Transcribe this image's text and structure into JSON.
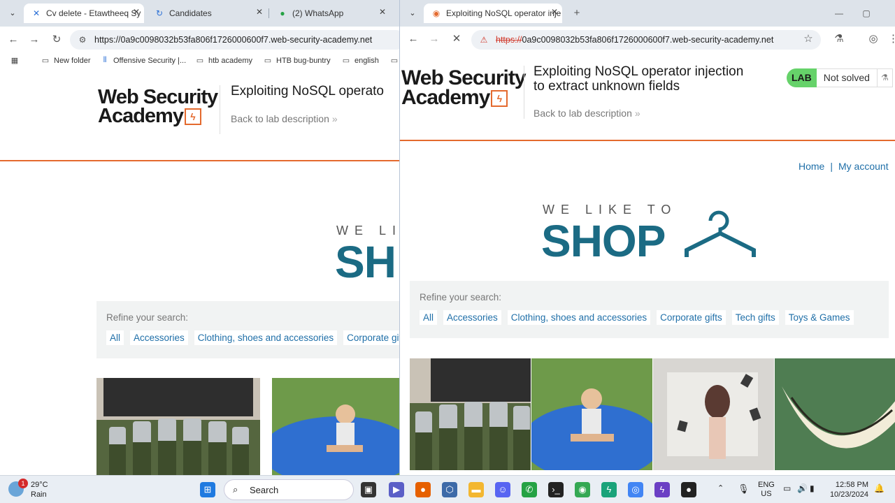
{
  "left_window": {
    "tabs": [
      {
        "label": "Cv delete - Etawtheeq Sy",
        "icon": "jira-icon"
      },
      {
        "label": "Candidates",
        "icon": "refresh-icon"
      },
      {
        "label": "(2) WhatsApp",
        "icon": "whatsapp-icon"
      }
    ],
    "url": "https://0a9c0098032b53fa806f1726000600f7.web-security-academy.net",
    "bookmarks": [
      "New folder",
      "Offensive Security |...",
      "htb academy",
      "HTB bug-buntry",
      "english"
    ],
    "lab_title": "Exploiting NoSQL operato",
    "back_link": "Back to lab description",
    "shop_small": "WE LI",
    "shop_large": "SH",
    "refine_label": "Refine your search:",
    "filters": [
      "All",
      "Accessories",
      "Clothing, shoes and accessories",
      "Corporate gif"
    ]
  },
  "right_window": {
    "tab_title": "Exploiting NoSQL operator inje",
    "url_scheme": "https://",
    "url_rest": "0a9c0098032b53fa806f1726000600f7.web-security-academy.net",
    "lab_title_line1": "Exploiting NoSQL operator injection",
    "lab_title_line2": "to extract unknown fields",
    "lab_badge": "LAB",
    "lab_status": "Not solved",
    "back_link": "Back to lab description",
    "nav_home": "Home",
    "nav_sep": "|",
    "nav_account": "My account",
    "shop_small": "WE LIKE TO",
    "shop_large": "SHOP",
    "refine_label": "Refine your search:",
    "filters": [
      "All",
      "Accessories",
      "Clothing, shoes and accessories",
      "Corporate gifts",
      "Tech gifts",
      "Toys & Games"
    ]
  },
  "logo": {
    "line1": "Web Security",
    "line2": "Academy"
  },
  "taskbar": {
    "weather_temp": "29°C",
    "weather_desc": "Rain",
    "weather_badge": "1",
    "search_placeholder": "Search",
    "lang_line1": "ENG",
    "lang_line2": "US",
    "time": "12:58 PM",
    "date": "10/23/2024"
  },
  "colors": {
    "accent_orange": "#e46a2e",
    "link_blue": "#1f6fa8",
    "shop_teal": "#1b6b84",
    "lab_green": "#66d26a"
  }
}
